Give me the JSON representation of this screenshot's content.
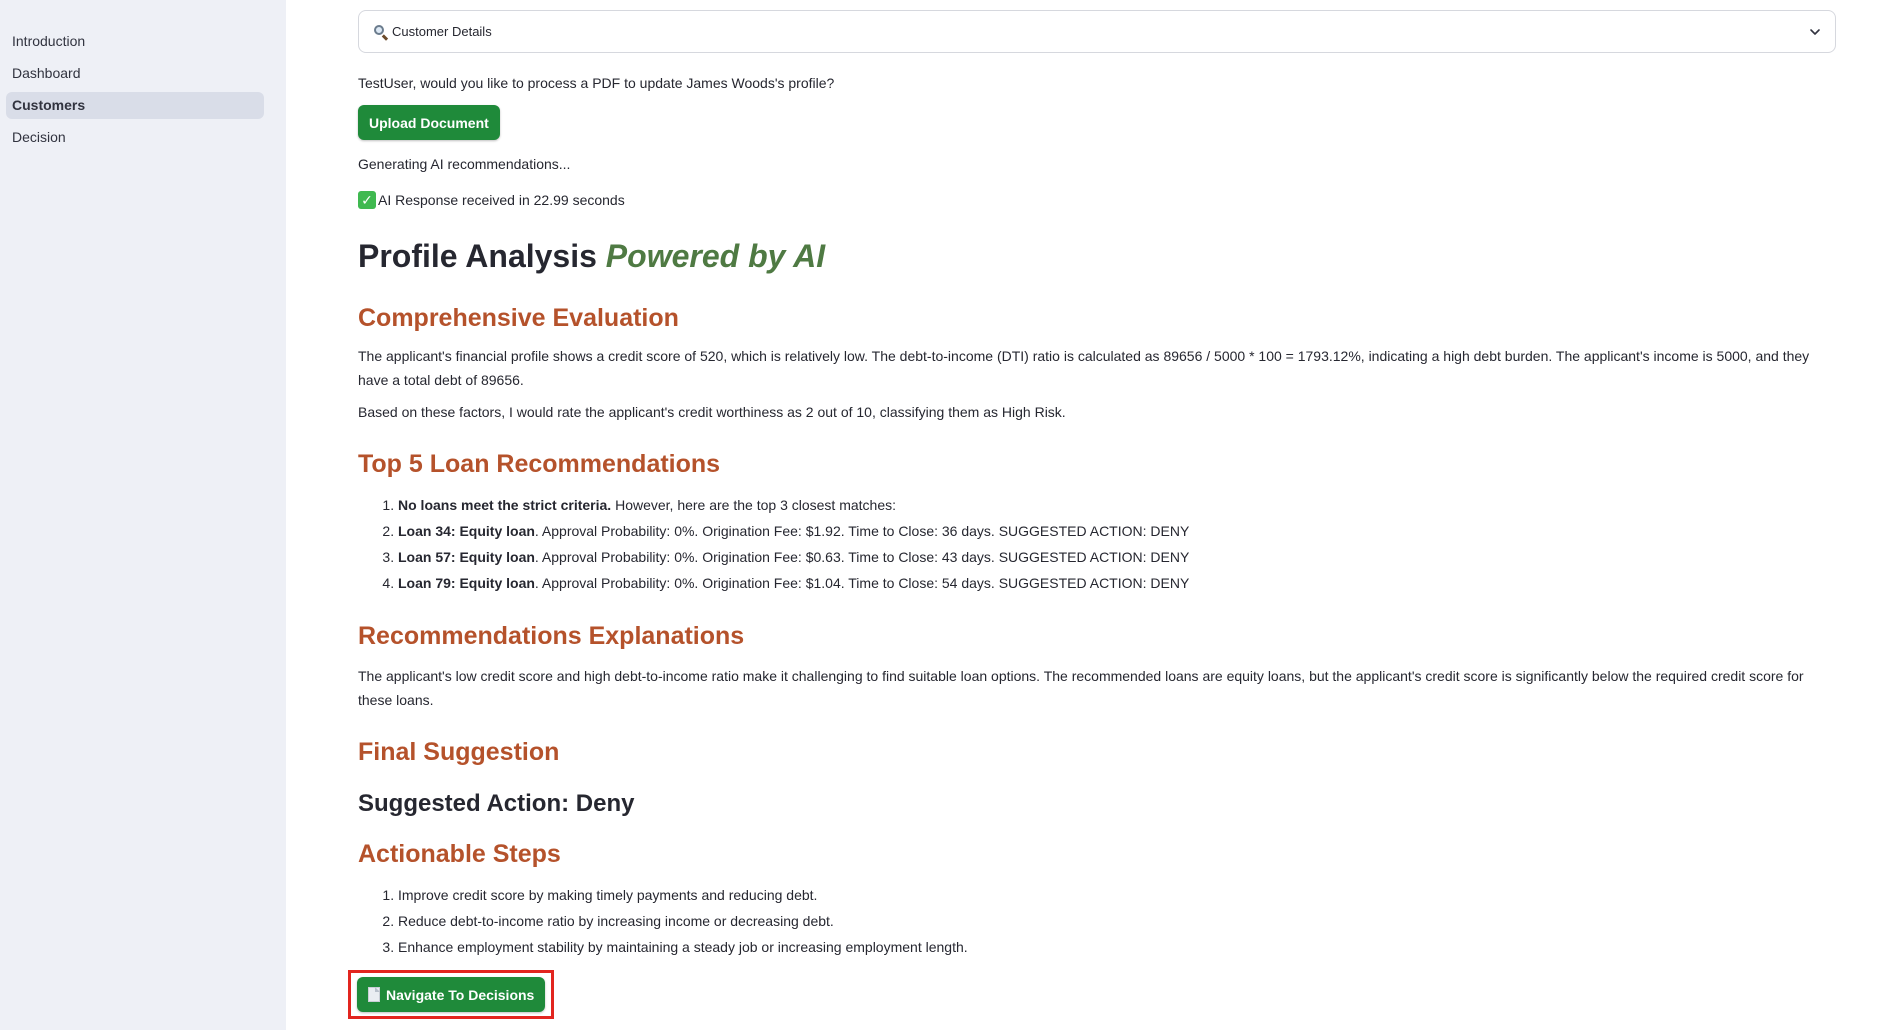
{
  "sidebar": {
    "items": [
      {
        "label": "Introduction",
        "active": false
      },
      {
        "label": "Dashboard",
        "active": false
      },
      {
        "label": "Customers",
        "active": true
      },
      {
        "label": "Decision",
        "active": false
      }
    ]
  },
  "expander": {
    "label": "Customer Details",
    "icon": "magnifier-icon"
  },
  "prompt": "TestUser, would you like to process a PDF to update James Woods's profile?",
  "upload_button": "Upload Document",
  "status": "Generating AI recommendations...",
  "success": {
    "icon": "check-icon",
    "text": "AI Response received in 22.99 seconds"
  },
  "title": {
    "main": "Profile Analysis ",
    "accent": "Powered by AI"
  },
  "sections": {
    "evaluation": {
      "heading": "Comprehensive Evaluation",
      "p1": "The applicant's financial profile shows a credit score of 520, which is relatively low. The debt-to-income (DTI) ratio is calculated as 89656 / 5000 * 100 = 1793.12%, indicating a high debt burden. The applicant's income is 5000, and they have a total debt of 89656.",
      "p2": "Based on these factors, I would rate the applicant's credit worthiness as 2 out of 10, classifying them as High Risk."
    },
    "top5": {
      "heading": "Top 5 Loan Recommendations",
      "items": [
        {
          "bold": "No loans meet the strict criteria.",
          "text": " However, here are the top 3 closest matches:"
        },
        {
          "bold": "Loan 34: Equity loan",
          "text": ". Approval Probability: 0%. Origination Fee: $1.92. Time to Close: 36 days. SUGGESTED ACTION: DENY"
        },
        {
          "bold": "Loan 57: Equity loan",
          "text": ". Approval Probability: 0%. Origination Fee: $0.63. Time to Close: 43 days. SUGGESTED ACTION: DENY"
        },
        {
          "bold": "Loan 79: Equity loan",
          "text": ". Approval Probability: 0%. Origination Fee: $1.04. Time to Close: 54 days. SUGGESTED ACTION: DENY"
        }
      ]
    },
    "explanations": {
      "heading": "Recommendations Explanations",
      "text": "The applicant's low credit score and high debt-to-income ratio make it challenging to find suitable loan options. The recommended loans are equity loans, but the applicant's credit score is significantly below the required credit score for these loans."
    },
    "final": {
      "heading": "Final Suggestion",
      "suggested": "Suggested Action: Deny"
    },
    "steps": {
      "heading": "Actionable Steps",
      "items": [
        "Improve credit score by making timely payments and reducing debt.",
        "Reduce debt-to-income ratio by increasing income or decreasing debt.",
        "Enhance employment stability by maintaining a steady job or increasing employment length."
      ]
    }
  },
  "navigate_button": {
    "label": "Navigate To Decisions",
    "icon": "document-icon"
  },
  "colors": {
    "sidebar_bg": "#eef0f6",
    "button_green": "#1f8a3a",
    "heading_orange": "#b5522b",
    "accent_green": "#4f7a43",
    "highlight_red": "#e2251f"
  }
}
